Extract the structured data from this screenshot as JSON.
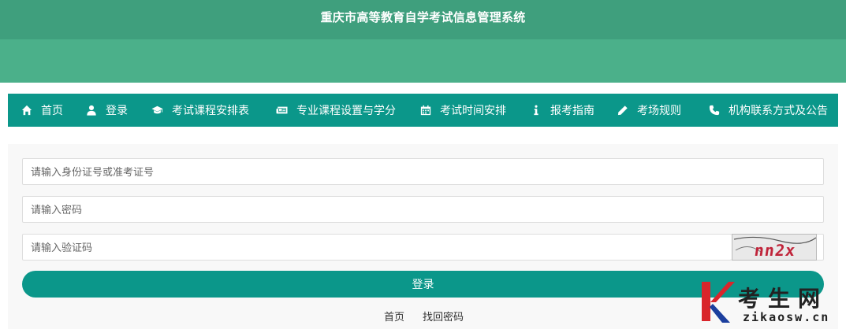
{
  "header": {
    "title": "重庆市高等教育自学考试信息管理系统"
  },
  "colors": {
    "header_top": "#3f9f7d",
    "header_band": "#4bb08a",
    "accent": "#0b978a",
    "watermark_red": "#d9252b",
    "watermark_blue": "#1c3f9e"
  },
  "nav": {
    "items": [
      {
        "label": "首页",
        "icon": "home-icon"
      },
      {
        "label": "登录",
        "icon": "user-icon"
      },
      {
        "label": "考试课程安排表",
        "icon": "graduation-cap-icon"
      },
      {
        "label": "专业课程设置与学分",
        "icon": "newspaper-icon"
      },
      {
        "label": "考试时间安排",
        "icon": "calendar-icon"
      },
      {
        "label": "报考指南",
        "icon": "info-icon"
      },
      {
        "label": "考场规则",
        "icon": "pencil-icon"
      },
      {
        "label": "机构联系方式及公告",
        "icon": "phone-icon"
      }
    ]
  },
  "form": {
    "id_placeholder": "请输入身份证号或准考证号",
    "password_placeholder": "请输入密码",
    "captcha_placeholder": "请输入验证码",
    "captcha_text": "nn2x",
    "login_label": "登录"
  },
  "footer": {
    "home_label": "首页",
    "recover_label": "找回密码"
  },
  "watermark": {
    "brand": "考生网",
    "domain": "zikaosw.cn"
  }
}
